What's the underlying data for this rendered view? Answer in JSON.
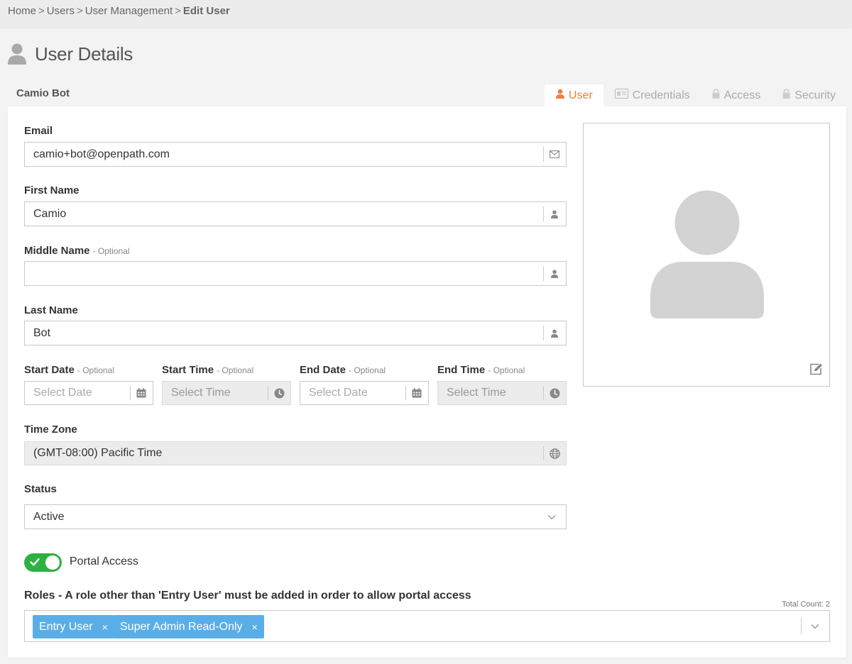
{
  "breadcrumb": {
    "items": [
      "Home",
      "Users",
      "User Management"
    ],
    "separator": ">",
    "current": "Edit User"
  },
  "page": {
    "title": "User Details",
    "icon": "user-silhouette-icon"
  },
  "user": {
    "display_name": "Camio Bot"
  },
  "tabs": [
    {
      "label": "User",
      "icon": "user-icon",
      "active": true
    },
    {
      "label": "Credentials",
      "icon": "id-card-icon",
      "active": false
    },
    {
      "label": "Access",
      "icon": "lock-icon",
      "active": false
    },
    {
      "label": "Security",
      "icon": "lock-icon",
      "active": false
    }
  ],
  "form": {
    "optional_tag": "- Optional",
    "email": {
      "label": "Email",
      "value": "camio+bot@openpath.com",
      "icon": "envelope-icon"
    },
    "first_name": {
      "label": "First Name",
      "value": "Camio",
      "icon": "user-icon"
    },
    "middle_name": {
      "label": "Middle Name",
      "value": "",
      "icon": "user-icon"
    },
    "last_name": {
      "label": "Last Name",
      "value": "Bot",
      "icon": "user-icon"
    },
    "start_date": {
      "label": "Start Date",
      "placeholder": "Select Date",
      "icon": "calendar-icon"
    },
    "start_time": {
      "label": "Start Time",
      "placeholder": "Select Time",
      "icon": "clock-icon"
    },
    "end_date": {
      "label": "End Date",
      "placeholder": "Select Date",
      "icon": "calendar-icon"
    },
    "end_time": {
      "label": "End Time",
      "placeholder": "Select Time",
      "icon": "clock-icon"
    },
    "time_zone": {
      "label": "Time Zone",
      "value": "(GMT-08:00) Pacific Time",
      "icon": "globe-icon"
    },
    "status": {
      "label": "Status",
      "value": "Active"
    },
    "portal_access": {
      "label": "Portal Access",
      "enabled": true
    },
    "roles": {
      "label": "Roles - A role other than 'Entry User' must be added in order to allow portal access",
      "total_count": "Total Count: 2",
      "items": [
        {
          "label": "Entry User",
          "remove": "×"
        },
        {
          "label": "Super Admin Read-Only",
          "remove": "×"
        }
      ]
    }
  },
  "colors": {
    "accent": "#ee7f3b",
    "toggle_on": "#2eb043",
    "chip": "#5aaee8",
    "icon_gray": "#888888"
  }
}
